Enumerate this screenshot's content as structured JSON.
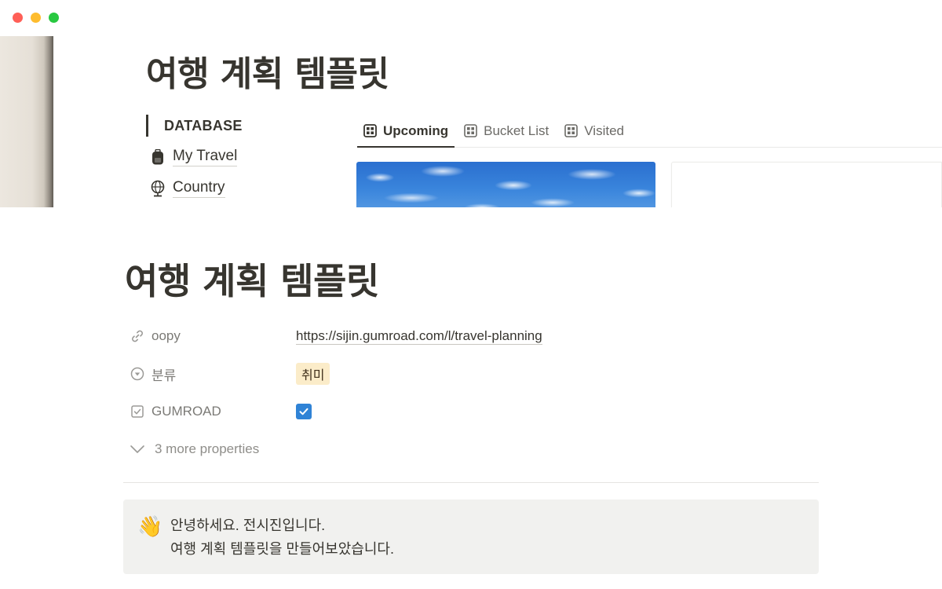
{
  "window": {
    "controls": [
      {
        "name": "close",
        "color": "#ff5f57"
      },
      {
        "name": "minimize",
        "color": "#febc2e"
      },
      {
        "name": "zoom",
        "color": "#28c840"
      }
    ]
  },
  "preview": {
    "title": "여행 계획 템플릿",
    "database_heading": "DATABASE",
    "database_links": [
      {
        "label": "My Travel",
        "icon": "backpack-icon"
      },
      {
        "label": "Country",
        "icon": "globe-icon"
      }
    ],
    "tabs": [
      {
        "label": "Upcoming",
        "icon": "gallery-icon",
        "active": true
      },
      {
        "label": "Bucket List",
        "icon": "gallery-icon",
        "active": false
      },
      {
        "label": "Visited",
        "icon": "gallery-icon",
        "active": false
      }
    ]
  },
  "page": {
    "title": "여행 계획 템플릿",
    "properties": {
      "oopy": {
        "name": "oopy",
        "icon": "link-icon",
        "value": "https://sijin.gumroad.com/l/travel-planning"
      },
      "category": {
        "name": "분류",
        "icon": "select-icon",
        "value": "취미",
        "tag_color": "#fbecc9"
      },
      "gumroad": {
        "name": "GUMROAD",
        "icon": "checkbox-icon",
        "checked": true,
        "check_color": "#2f83d6"
      }
    },
    "more_properties": "3 more properties",
    "callout": {
      "emoji": "👋",
      "line1": "안녕하세요. 전시진입니다.",
      "line2": "여행 계획 템플릿을 만들어보았습니다."
    }
  }
}
